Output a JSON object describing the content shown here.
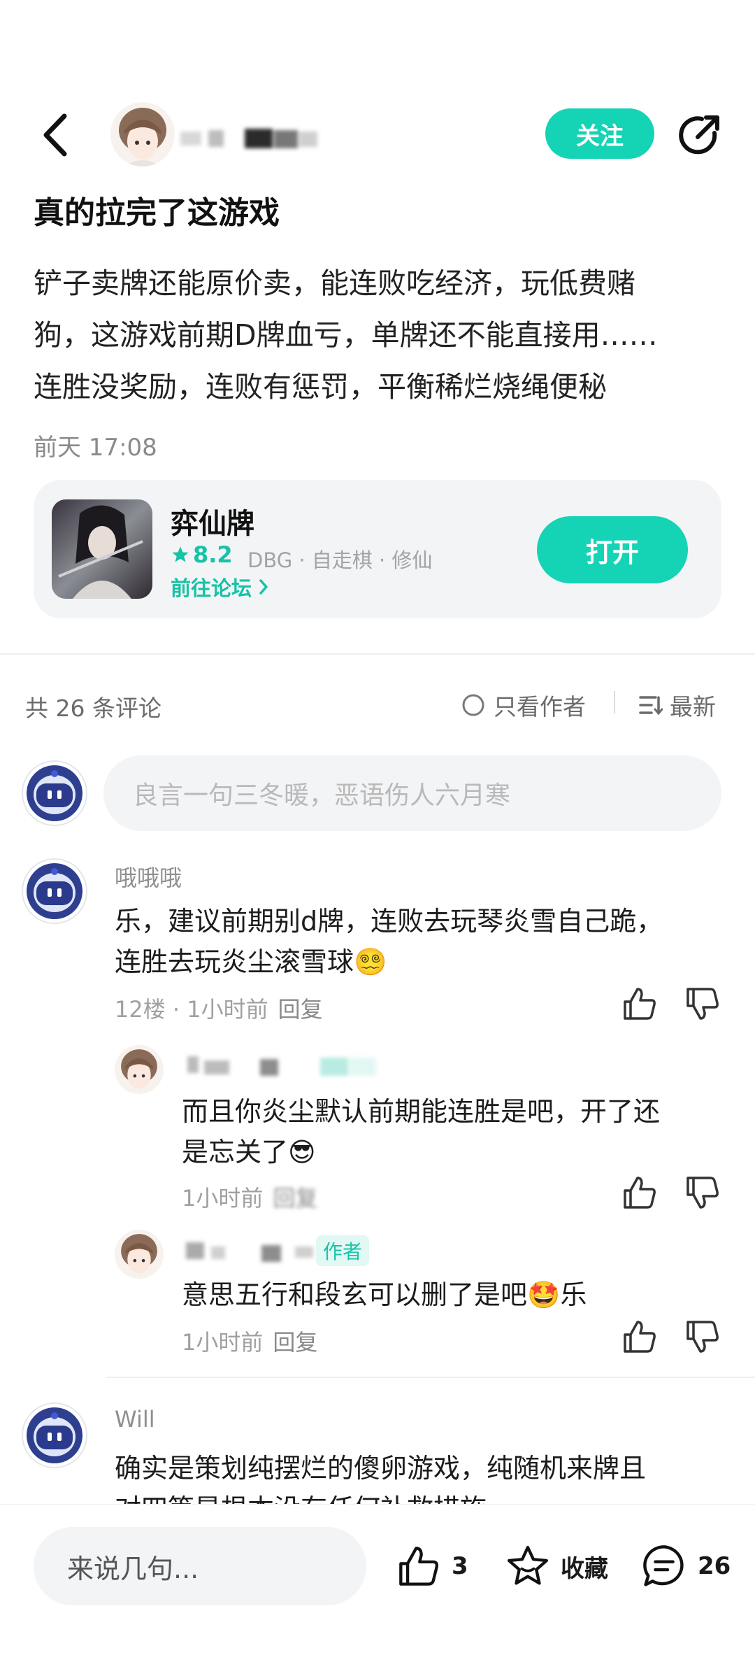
{
  "header": {
    "follow_label": "关注"
  },
  "post": {
    "title": "真的拉完了这游戏",
    "body_lines": [
      "铲子卖牌还能原价卖，能连败吃经济，玩低费赌",
      "狗，这游戏前期D牌血亏，单牌还不能直接用……",
      "连胜没奖励，连败有惩罚，平衡稀烂烧绳便秘"
    ],
    "time": "前天 17:08"
  },
  "game_card": {
    "name": "弈仙牌",
    "rating": "8.2",
    "tags": "DBG · 自走棋 · 修仙",
    "forum_link": "前往论坛",
    "open_label": "打开"
  },
  "comments_header": {
    "count_text": "共 26 条评论",
    "author_only": "只看作者",
    "sort": "最新"
  },
  "comment_input": {
    "placeholder": "良言一句三冬暖，恶语伤人六月寒"
  },
  "comments": [
    {
      "username": "哦哦哦",
      "lines": [
        "乐，建议前期别d牌，连败去玩琴炎雪自己跪，",
        "连胜去玩炎尘滚雪球😵‍💫"
      ],
      "meta": "12楼 · 1小时前",
      "reply_label": "回复"
    }
  ],
  "replies": [
    {
      "lines": [
        "而且你炎尘默认前期能连胜是吧，开了还",
        "是忘关了😎"
      ],
      "meta": "1小时前",
      "reply_label": "回复"
    },
    {
      "author_tag": "作者",
      "lines": [
        "意思五行和段玄可以删了是吧🤩乐"
      ],
      "meta": "1小时前",
      "reply_label": "回复"
    }
  ],
  "comment_2": {
    "username": "Will",
    "lines": [
      "确实是策划纯摆烂的傻卵游戏，纯随机来牌且",
      "对四等是根本没有任何补救措施"
    ]
  },
  "bottom_bar": {
    "say_placeholder": "来说几句...",
    "like_count": "3",
    "favorite_label": "收藏",
    "comment_count": "26"
  },
  "colors": {
    "accent": "#15d3b5",
    "accent_text": "#15c3a6"
  },
  "icons": [
    "back-arrow-icon",
    "share-icon",
    "star-icon",
    "chevron-right-icon",
    "circle-icon",
    "sort-icon",
    "thumb-up-icon",
    "thumb-down-icon",
    "favorite-star-icon",
    "comment-bubble-icon"
  ]
}
